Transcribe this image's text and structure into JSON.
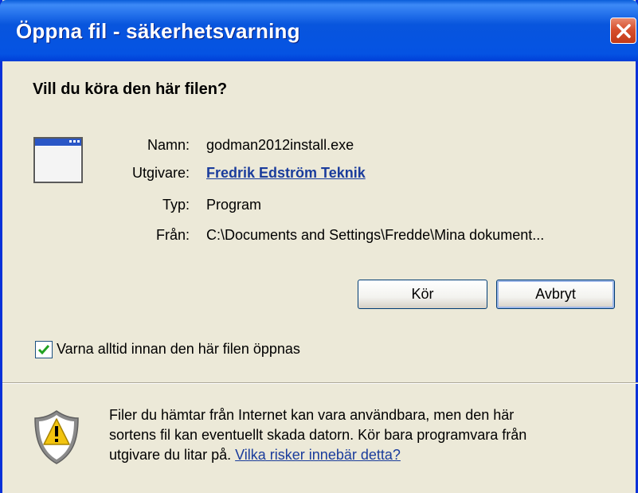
{
  "window": {
    "title": "Öppna fil - säkerhetsvarning"
  },
  "heading": "Vill du köra den här filen?",
  "fields": [
    {
      "label": "Namn:",
      "value": "godman2012install.exe"
    },
    {
      "label": "Utgivare:",
      "value": "Fredrik Edström Teknik"
    },
    {
      "label": "Typ:",
      "value": "Program"
    },
    {
      "label": "Från:",
      "value": "C:\\Documents and Settings\\Fredde\\Mina dokument..."
    }
  ],
  "buttons": {
    "run_label": "Kör",
    "cancel_label": "Avbryt"
  },
  "checkbox": {
    "label": "Varna alltid innan den här filen öppnas",
    "checked": true
  },
  "warning": {
    "line1": "Filer du hämtar från Internet kan vara användbara, men den här",
    "line2": "sortens fil kan eventuellt skada datorn. Kör bara programvara från",
    "line3_prefix": "utgivare du litar på.",
    "link": "Vilka risker innebär detta?"
  },
  "icons": {
    "close": "close-icon",
    "program": "program-window-icon",
    "check": "check-icon",
    "warning": "security-shield-icon"
  },
  "colors": {
    "titlebar": "#0855dd",
    "dialog_bg": "#ece9d8",
    "link": "#1a3c9c",
    "close_button": "#d7502e"
  }
}
